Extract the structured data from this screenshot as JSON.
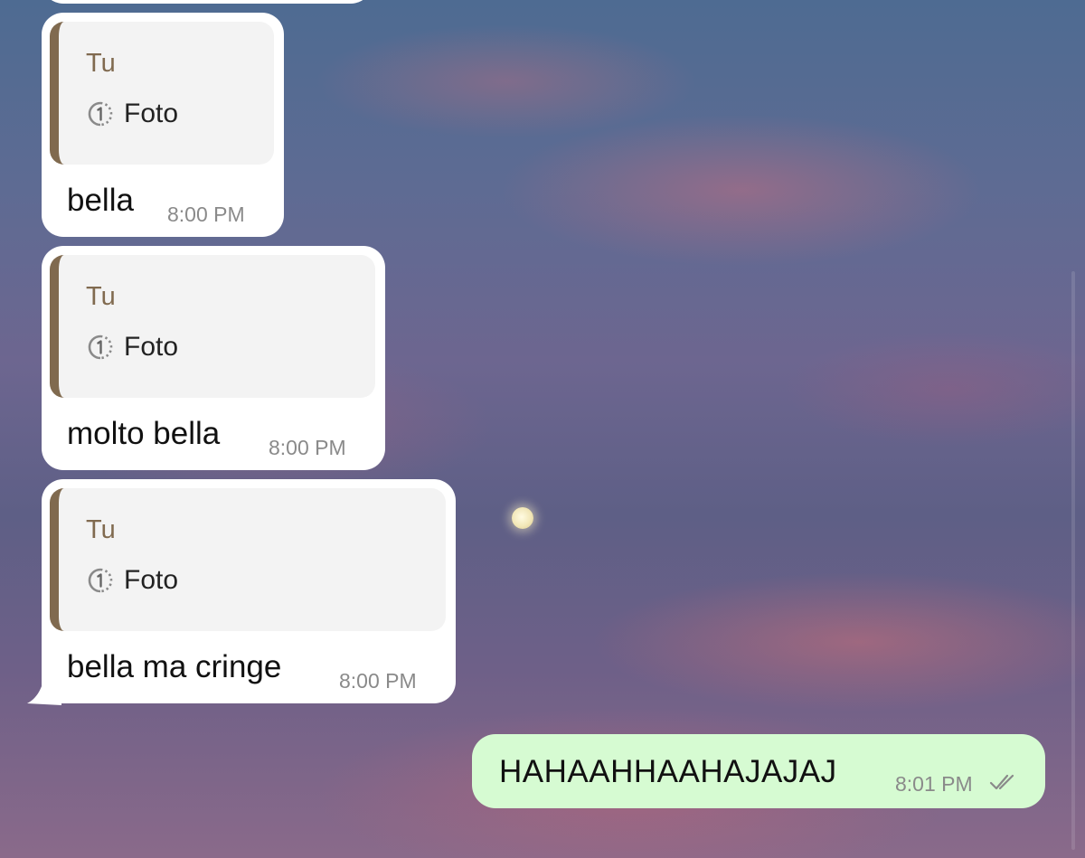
{
  "chat": {
    "messages": [
      {
        "quote_author": "Tu",
        "quote_media": "Foto",
        "text": "bella",
        "time": "8:00 PM"
      },
      {
        "quote_author": "Tu",
        "quote_media": "Foto",
        "text": "molto bella",
        "time": "8:00 PM"
      },
      {
        "quote_author": "Tu",
        "quote_media": "Foto",
        "text": "bella ma cringe",
        "time": "8:00 PM"
      }
    ],
    "outgoing": {
      "text": "HAHAAHHAAHAJAJAJ",
      "time": "8:01 PM",
      "status_icon": "double-check-icon"
    }
  },
  "colors": {
    "incoming_bubble": "#ffffff",
    "outgoing_bubble": "#d6fbd2",
    "quote_accent": "#806a4f",
    "timestamp": "#8a8a8a"
  },
  "icons": {
    "view_once": "view-once-icon",
    "read_receipt": "double-check-icon"
  }
}
